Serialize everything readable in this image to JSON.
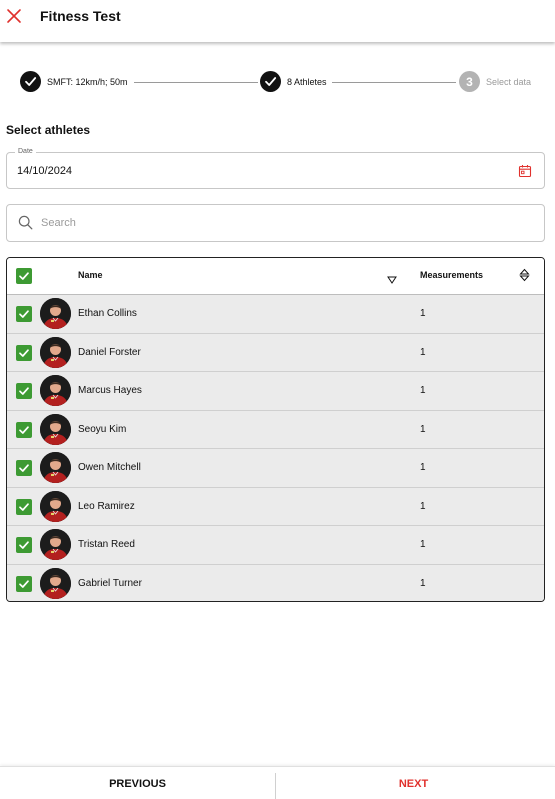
{
  "header": {
    "title": "Fitness Test",
    "close_icon": "close-icon",
    "accent": "#e0312d"
  },
  "stepper": {
    "steps": [
      {
        "label": "SMFT: 12km/h; 50m",
        "state": "done"
      },
      {
        "label": "8 Athletes",
        "state": "done"
      },
      {
        "number": "3",
        "label": "Select data",
        "state": "pending"
      }
    ]
  },
  "section_title": "Select athletes",
  "date": {
    "label": "Date",
    "value": "14/10/2024",
    "icon": "calendar-icon"
  },
  "search": {
    "placeholder": "Search",
    "value": "",
    "icon": "search-icon"
  },
  "table": {
    "columns": {
      "name": "Name",
      "measurements": "Measurements"
    },
    "select_all_checked": true,
    "rows": [
      {
        "name": "Ethan Collins",
        "measurements": "1",
        "checked": true
      },
      {
        "name": "Daniel Forster",
        "measurements": "1",
        "checked": true
      },
      {
        "name": "Marcus Hayes",
        "measurements": "1",
        "checked": true
      },
      {
        "name": "Seoyu Kim",
        "measurements": "1",
        "checked": true
      },
      {
        "name": "Owen Mitchell",
        "measurements": "1",
        "checked": true
      },
      {
        "name": "Leo Ramirez",
        "measurements": "1",
        "checked": true
      },
      {
        "name": "Tristan Reed",
        "measurements": "1",
        "checked": true
      },
      {
        "name": "Gabriel Turner",
        "measurements": "1",
        "checked": true
      }
    ],
    "checkbox_color": "#3d9a33"
  },
  "footer": {
    "previous": "PREVIOUS",
    "next": "NEXT"
  }
}
